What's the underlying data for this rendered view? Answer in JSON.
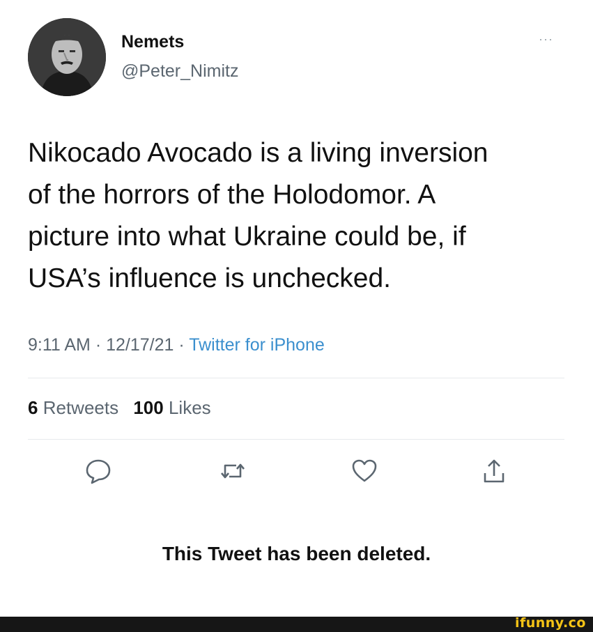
{
  "user": {
    "display_name": "Nemets",
    "handle": "@Peter_Nimitz",
    "avatar_icon": "portrait-avatar"
  },
  "more_label": "···",
  "tweet": {
    "text": "Nikocado Avocado is a living inversion\nof the horrors of the Holodomor. A\npicture into what Ukraine could be, if\nUSA’s influence is unchecked.",
    "time": "9:11 AM",
    "date": "12/17/21",
    "separator": "·",
    "source": "Twitter for iPhone"
  },
  "stats": {
    "retweets_count": "6",
    "retweets_label": "Retweets",
    "likes_count": "100",
    "likes_label": "Likes"
  },
  "actions": [
    {
      "name": "reply",
      "icon": "speech-bubble-icon"
    },
    {
      "name": "retweet",
      "icon": "retweet-arrows-icon"
    },
    {
      "name": "like",
      "icon": "heart-icon"
    },
    {
      "name": "share",
      "icon": "share-upload-icon"
    }
  ],
  "deleted_notice": "This Tweet has been deleted.",
  "watermark": "ifunny.co",
  "colors": {
    "text": "#111111",
    "secondary": "#5b6670",
    "link": "#3b8fce",
    "divider": "#e6e9ec",
    "watermark": "#f6c416"
  }
}
